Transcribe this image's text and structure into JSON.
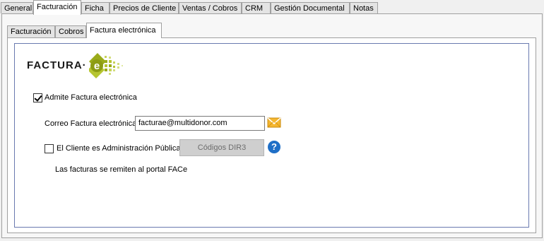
{
  "top_tabs": [
    {
      "label": "General"
    },
    {
      "label": "Facturación"
    },
    {
      "label": "Ficha"
    },
    {
      "label": "Precios de Cliente"
    },
    {
      "label": "Ventas / Cobros"
    },
    {
      "label": "CRM"
    },
    {
      "label": "Gestión Documental"
    },
    {
      "label": "Notas"
    }
  ],
  "inner_tabs": [
    {
      "label": "Facturación"
    },
    {
      "label": "Cobros"
    },
    {
      "label": "Factura electrónica"
    }
  ],
  "logo": {
    "text": "FACTURA·",
    "mark_letter": "e",
    "accent_color": "#9aab1a"
  },
  "admite": {
    "label": "Admite Factura electrónica",
    "checked": true
  },
  "email": {
    "label": "Correo Factura electrónica",
    "value": "facturae@multidonor.com",
    "button_icon": "mail-icon"
  },
  "admin_publica": {
    "label": "El Cliente es Administración Pública",
    "checked": false
  },
  "dir3_button": {
    "label": "Códigos DIR3",
    "enabled": false
  },
  "help": {
    "icon": "help-icon",
    "glyph": "?"
  },
  "note": {
    "text": "Las facturas se remiten al portal FACe"
  }
}
